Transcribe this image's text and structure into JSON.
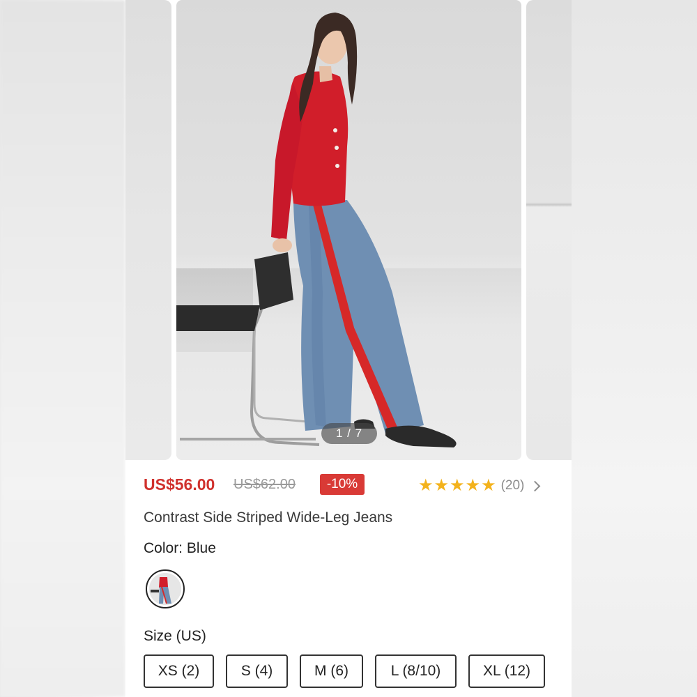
{
  "gallery": {
    "counter": "1 / 7",
    "image_subject": "product-photo-model-red-cardigan-striped-jeans"
  },
  "product": {
    "price": "US$56.00",
    "original_price": "US$62.00",
    "discount": "-10%",
    "rating_stars": 5,
    "review_count": "(20)",
    "title": "Contrast Side Striped Wide-Leg Jeans",
    "color_label": "Color: Blue",
    "size_label": "Size (US)",
    "sizes": [
      "XS (2)",
      "S (4)",
      "M (6)",
      "L (8/10)",
      "XL (12)"
    ]
  },
  "colors": {
    "price_red": "#d0312d",
    "discount_bg": "#d93a36",
    "star_yellow": "#f3b21c"
  }
}
